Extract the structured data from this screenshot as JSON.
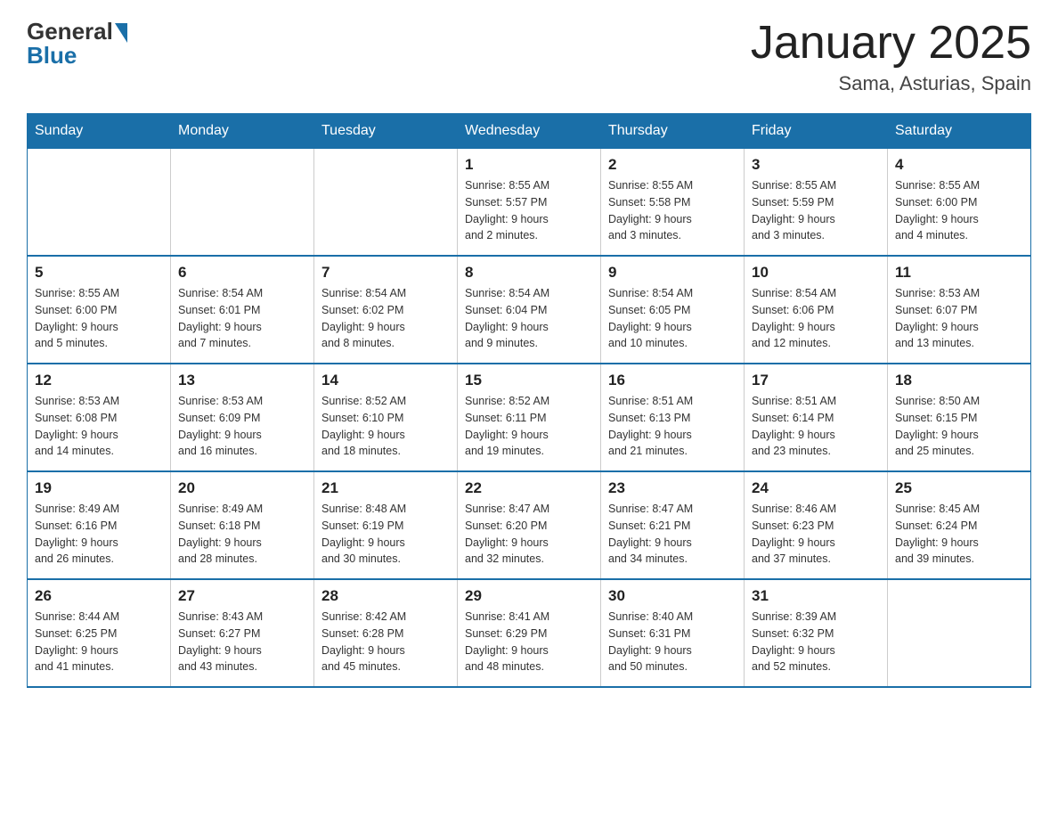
{
  "header": {
    "logo_general": "General",
    "logo_blue": "Blue",
    "month_title": "January 2025",
    "location": "Sama, Asturias, Spain"
  },
  "days_of_week": [
    "Sunday",
    "Monday",
    "Tuesday",
    "Wednesday",
    "Thursday",
    "Friday",
    "Saturday"
  ],
  "weeks": [
    [
      {
        "day": "",
        "info": ""
      },
      {
        "day": "",
        "info": ""
      },
      {
        "day": "",
        "info": ""
      },
      {
        "day": "1",
        "info": "Sunrise: 8:55 AM\nSunset: 5:57 PM\nDaylight: 9 hours\nand 2 minutes."
      },
      {
        "day": "2",
        "info": "Sunrise: 8:55 AM\nSunset: 5:58 PM\nDaylight: 9 hours\nand 3 minutes."
      },
      {
        "day": "3",
        "info": "Sunrise: 8:55 AM\nSunset: 5:59 PM\nDaylight: 9 hours\nand 3 minutes."
      },
      {
        "day": "4",
        "info": "Sunrise: 8:55 AM\nSunset: 6:00 PM\nDaylight: 9 hours\nand 4 minutes."
      }
    ],
    [
      {
        "day": "5",
        "info": "Sunrise: 8:55 AM\nSunset: 6:00 PM\nDaylight: 9 hours\nand 5 minutes."
      },
      {
        "day": "6",
        "info": "Sunrise: 8:54 AM\nSunset: 6:01 PM\nDaylight: 9 hours\nand 7 minutes."
      },
      {
        "day": "7",
        "info": "Sunrise: 8:54 AM\nSunset: 6:02 PM\nDaylight: 9 hours\nand 8 minutes."
      },
      {
        "day": "8",
        "info": "Sunrise: 8:54 AM\nSunset: 6:04 PM\nDaylight: 9 hours\nand 9 minutes."
      },
      {
        "day": "9",
        "info": "Sunrise: 8:54 AM\nSunset: 6:05 PM\nDaylight: 9 hours\nand 10 minutes."
      },
      {
        "day": "10",
        "info": "Sunrise: 8:54 AM\nSunset: 6:06 PM\nDaylight: 9 hours\nand 12 minutes."
      },
      {
        "day": "11",
        "info": "Sunrise: 8:53 AM\nSunset: 6:07 PM\nDaylight: 9 hours\nand 13 minutes."
      }
    ],
    [
      {
        "day": "12",
        "info": "Sunrise: 8:53 AM\nSunset: 6:08 PM\nDaylight: 9 hours\nand 14 minutes."
      },
      {
        "day": "13",
        "info": "Sunrise: 8:53 AM\nSunset: 6:09 PM\nDaylight: 9 hours\nand 16 minutes."
      },
      {
        "day": "14",
        "info": "Sunrise: 8:52 AM\nSunset: 6:10 PM\nDaylight: 9 hours\nand 18 minutes."
      },
      {
        "day": "15",
        "info": "Sunrise: 8:52 AM\nSunset: 6:11 PM\nDaylight: 9 hours\nand 19 minutes."
      },
      {
        "day": "16",
        "info": "Sunrise: 8:51 AM\nSunset: 6:13 PM\nDaylight: 9 hours\nand 21 minutes."
      },
      {
        "day": "17",
        "info": "Sunrise: 8:51 AM\nSunset: 6:14 PM\nDaylight: 9 hours\nand 23 minutes."
      },
      {
        "day": "18",
        "info": "Sunrise: 8:50 AM\nSunset: 6:15 PM\nDaylight: 9 hours\nand 25 minutes."
      }
    ],
    [
      {
        "day": "19",
        "info": "Sunrise: 8:49 AM\nSunset: 6:16 PM\nDaylight: 9 hours\nand 26 minutes."
      },
      {
        "day": "20",
        "info": "Sunrise: 8:49 AM\nSunset: 6:18 PM\nDaylight: 9 hours\nand 28 minutes."
      },
      {
        "day": "21",
        "info": "Sunrise: 8:48 AM\nSunset: 6:19 PM\nDaylight: 9 hours\nand 30 minutes."
      },
      {
        "day": "22",
        "info": "Sunrise: 8:47 AM\nSunset: 6:20 PM\nDaylight: 9 hours\nand 32 minutes."
      },
      {
        "day": "23",
        "info": "Sunrise: 8:47 AM\nSunset: 6:21 PM\nDaylight: 9 hours\nand 34 minutes."
      },
      {
        "day": "24",
        "info": "Sunrise: 8:46 AM\nSunset: 6:23 PM\nDaylight: 9 hours\nand 37 minutes."
      },
      {
        "day": "25",
        "info": "Sunrise: 8:45 AM\nSunset: 6:24 PM\nDaylight: 9 hours\nand 39 minutes."
      }
    ],
    [
      {
        "day": "26",
        "info": "Sunrise: 8:44 AM\nSunset: 6:25 PM\nDaylight: 9 hours\nand 41 minutes."
      },
      {
        "day": "27",
        "info": "Sunrise: 8:43 AM\nSunset: 6:27 PM\nDaylight: 9 hours\nand 43 minutes."
      },
      {
        "day": "28",
        "info": "Sunrise: 8:42 AM\nSunset: 6:28 PM\nDaylight: 9 hours\nand 45 minutes."
      },
      {
        "day": "29",
        "info": "Sunrise: 8:41 AM\nSunset: 6:29 PM\nDaylight: 9 hours\nand 48 minutes."
      },
      {
        "day": "30",
        "info": "Sunrise: 8:40 AM\nSunset: 6:31 PM\nDaylight: 9 hours\nand 50 minutes."
      },
      {
        "day": "31",
        "info": "Sunrise: 8:39 AM\nSunset: 6:32 PM\nDaylight: 9 hours\nand 52 minutes."
      },
      {
        "day": "",
        "info": ""
      }
    ]
  ]
}
